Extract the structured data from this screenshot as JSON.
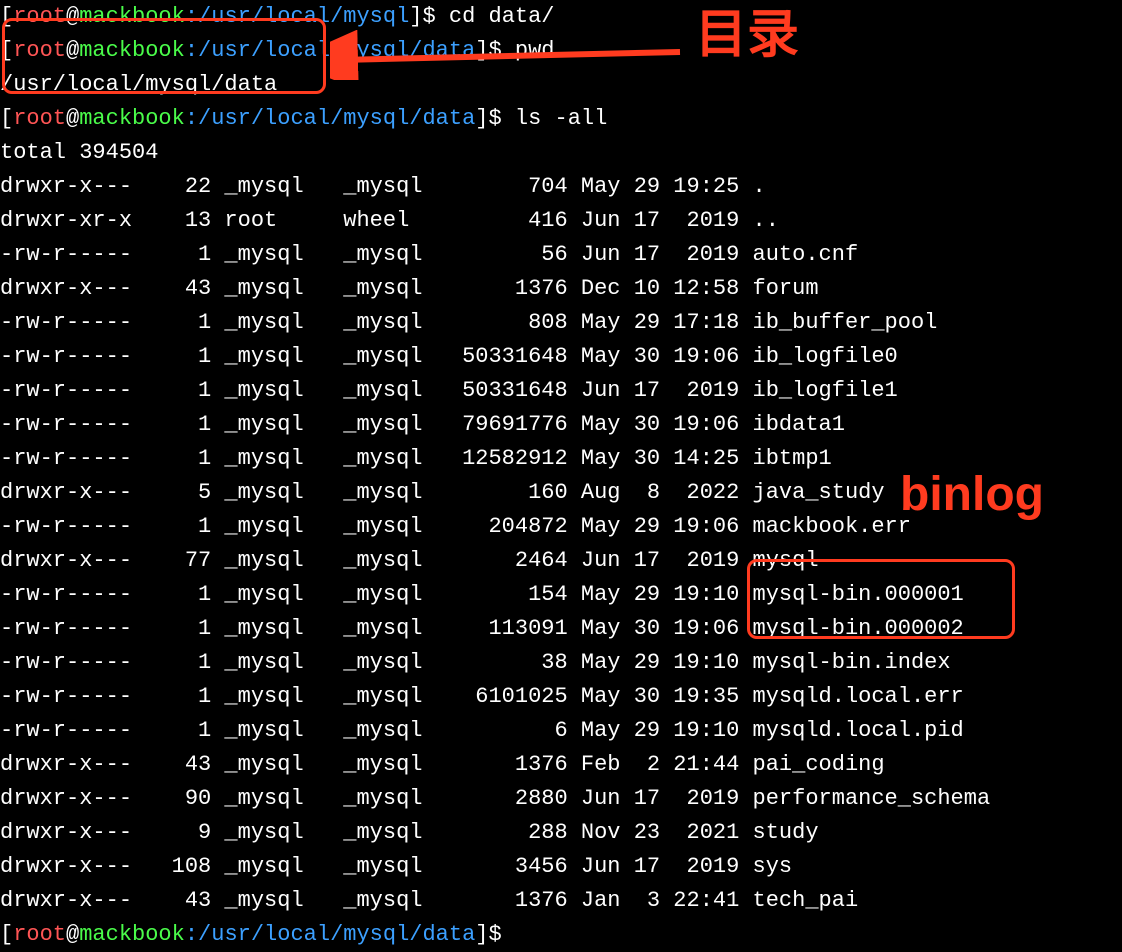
{
  "prompt": {
    "user": "root",
    "at": "@",
    "host": "mackbook",
    "colon": ":",
    "path_short": "/usr/local/mysql",
    "path_full": "/usr/local/mysql/data",
    "bracket_open": "[",
    "bracket_close": "]",
    "dollar": "$"
  },
  "commands": {
    "cd": "cd data/",
    "pwd": "pwd",
    "pwd_out": "/usr/local/mysql/data",
    "ls": "ls -all",
    "total": "total 394504"
  },
  "listing": [
    {
      "perm": "drwxr-x---",
      "links": "22",
      "owner": "_mysql",
      "group": "_mysql",
      "size": "704",
      "month": "May",
      "day": "29",
      "time": "19:25",
      "name": "."
    },
    {
      "perm": "drwxr-xr-x",
      "links": "13",
      "owner": "root",
      "group": "wheel",
      "size": "416",
      "month": "Jun",
      "day": "17",
      "time": "2019",
      "name": ".."
    },
    {
      "perm": "-rw-r-----",
      "links": "1",
      "owner": "_mysql",
      "group": "_mysql",
      "size": "56",
      "month": "Jun",
      "day": "17",
      "time": "2019",
      "name": "auto.cnf"
    },
    {
      "perm": "drwxr-x---",
      "links": "43",
      "owner": "_mysql",
      "group": "_mysql",
      "size": "1376",
      "month": "Dec",
      "day": "10",
      "time": "12:58",
      "name": "forum"
    },
    {
      "perm": "-rw-r-----",
      "links": "1",
      "owner": "_mysql",
      "group": "_mysql",
      "size": "808",
      "month": "May",
      "day": "29",
      "time": "17:18",
      "name": "ib_buffer_pool"
    },
    {
      "perm": "-rw-r-----",
      "links": "1",
      "owner": "_mysql",
      "group": "_mysql",
      "size": "50331648",
      "month": "May",
      "day": "30",
      "time": "19:06",
      "name": "ib_logfile0"
    },
    {
      "perm": "-rw-r-----",
      "links": "1",
      "owner": "_mysql",
      "group": "_mysql",
      "size": "50331648",
      "month": "Jun",
      "day": "17",
      "time": "2019",
      "name": "ib_logfile1"
    },
    {
      "perm": "-rw-r-----",
      "links": "1",
      "owner": "_mysql",
      "group": "_mysql",
      "size": "79691776",
      "month": "May",
      "day": "30",
      "time": "19:06",
      "name": "ibdata1"
    },
    {
      "perm": "-rw-r-----",
      "links": "1",
      "owner": "_mysql",
      "group": "_mysql",
      "size": "12582912",
      "month": "May",
      "day": "30",
      "time": "14:25",
      "name": "ibtmp1"
    },
    {
      "perm": "drwxr-x---",
      "links": "5",
      "owner": "_mysql",
      "group": "_mysql",
      "size": "160",
      "month": "Aug",
      "day": "8",
      "time": "2022",
      "name": "java_study"
    },
    {
      "perm": "-rw-r-----",
      "links": "1",
      "owner": "_mysql",
      "group": "_mysql",
      "size": "204872",
      "month": "May",
      "day": "29",
      "time": "19:06",
      "name": "mackbook.err"
    },
    {
      "perm": "drwxr-x---",
      "links": "77",
      "owner": "_mysql",
      "group": "_mysql",
      "size": "2464",
      "month": "Jun",
      "day": "17",
      "time": "2019",
      "name": "mysql"
    },
    {
      "perm": "-rw-r-----",
      "links": "1",
      "owner": "_mysql",
      "group": "_mysql",
      "size": "154",
      "month": "May",
      "day": "29",
      "time": "19:10",
      "name": "mysql-bin.000001"
    },
    {
      "perm": "-rw-r-----",
      "links": "1",
      "owner": "_mysql",
      "group": "_mysql",
      "size": "113091",
      "month": "May",
      "day": "30",
      "time": "19:06",
      "name": "mysql-bin.000002"
    },
    {
      "perm": "-rw-r-----",
      "links": "1",
      "owner": "_mysql",
      "group": "_mysql",
      "size": "38",
      "month": "May",
      "day": "29",
      "time": "19:10",
      "name": "mysql-bin.index"
    },
    {
      "perm": "-rw-r-----",
      "links": "1",
      "owner": "_mysql",
      "group": "_mysql",
      "size": "6101025",
      "month": "May",
      "day": "30",
      "time": "19:35",
      "name": "mysqld.local.err"
    },
    {
      "perm": "-rw-r-----",
      "links": "1",
      "owner": "_mysql",
      "group": "_mysql",
      "size": "6",
      "month": "May",
      "day": "29",
      "time": "19:10",
      "name": "mysqld.local.pid"
    },
    {
      "perm": "drwxr-x---",
      "links": "43",
      "owner": "_mysql",
      "group": "_mysql",
      "size": "1376",
      "month": "Feb",
      "day": "2",
      "time": "21:44",
      "name": "pai_coding"
    },
    {
      "perm": "drwxr-x---",
      "links": "90",
      "owner": "_mysql",
      "group": "_mysql",
      "size": "2880",
      "month": "Jun",
      "day": "17",
      "time": "2019",
      "name": "performance_schema"
    },
    {
      "perm": "drwxr-x---",
      "links": "9",
      "owner": "_mysql",
      "group": "_mysql",
      "size": "288",
      "month": "Nov",
      "day": "23",
      "time": "2021",
      "name": "study"
    },
    {
      "perm": "drwxr-x---",
      "links": "108",
      "owner": "_mysql",
      "group": "_mysql",
      "size": "3456",
      "month": "Jun",
      "day": "17",
      "time": "2019",
      "name": "sys"
    },
    {
      "perm": "drwxr-x---",
      "links": "43",
      "owner": "_mysql",
      "group": "_mysql",
      "size": "1376",
      "month": "Jan",
      "day": "3",
      "time": "22:41",
      "name": "tech_pai"
    }
  ],
  "annotations": {
    "dir_label": "目录",
    "binlog_label": "binlog"
  }
}
